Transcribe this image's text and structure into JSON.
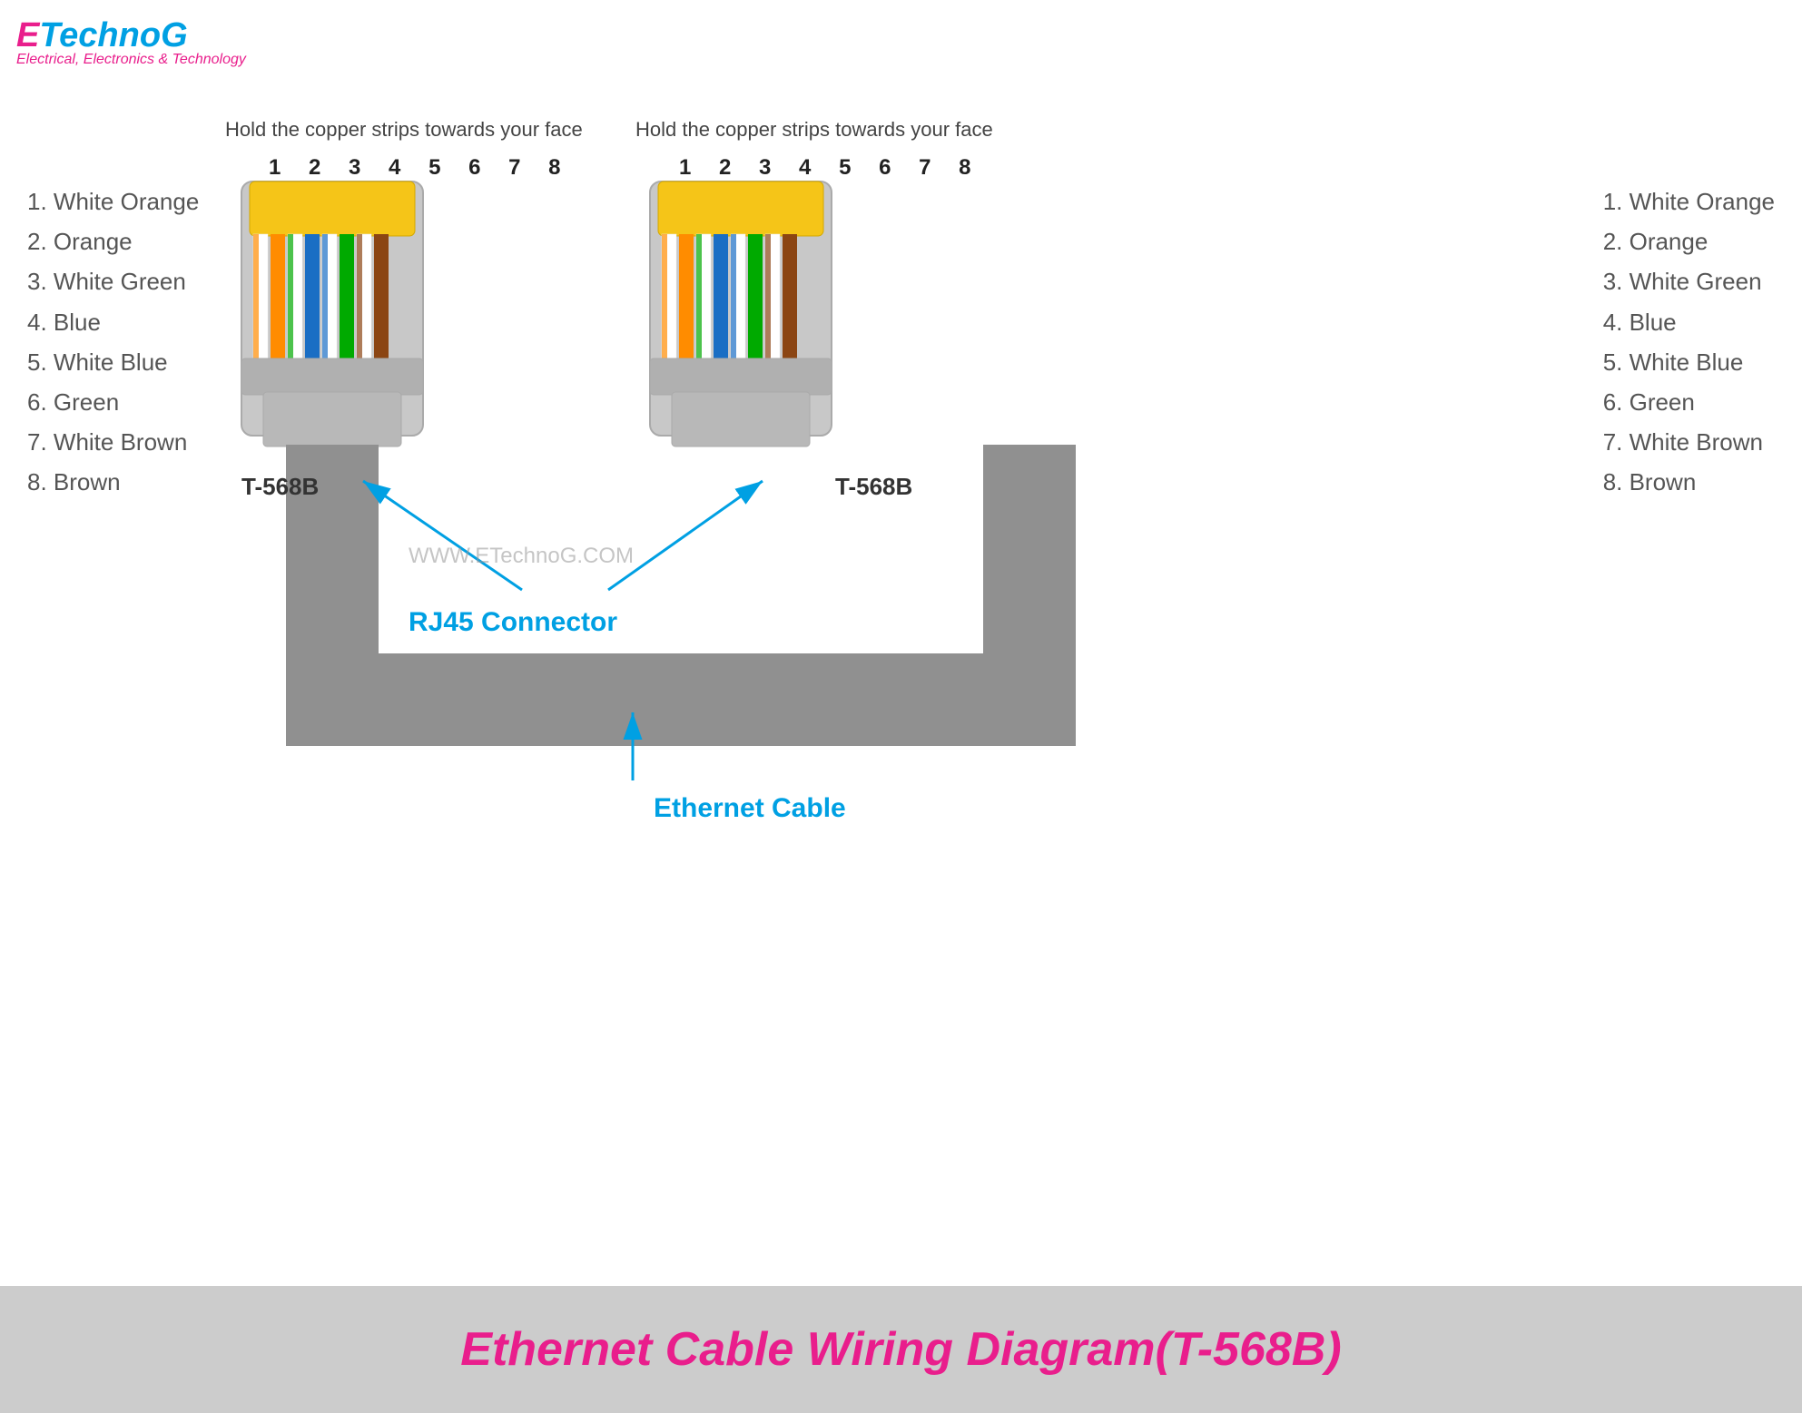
{
  "logo": {
    "e": "E",
    "technog": "TechnoG",
    "tagline": "Electrical, Electronics & Technology"
  },
  "left_connector": {
    "instruction": "Hold the copper strips towards your face",
    "pin_numbers": "1 2 3 4 5 6 7 8",
    "label": "T-568B",
    "wires": [
      {
        "num": "1.",
        "color": "White Orange"
      },
      {
        "num": "2.",
        "color": "Orange"
      },
      {
        "num": "3.",
        "color": "White Green"
      },
      {
        "num": "4.",
        "color": "Blue"
      },
      {
        "num": "5.",
        "color": "White Blue"
      },
      {
        "num": "6.",
        "color": "Green"
      },
      {
        "num": "7.",
        "color": "White Brown"
      },
      {
        "num": "8.",
        "color": "Brown"
      }
    ]
  },
  "right_connector": {
    "instruction": "Hold the copper strips towards your face",
    "pin_numbers": "1 2 3 4 5 6 7 8",
    "label": "T-568B",
    "wires": [
      {
        "num": "1.",
        "color": "White Orange"
      },
      {
        "num": "2.",
        "color": "Orange"
      },
      {
        "num": "3.",
        "color": "White Green"
      },
      {
        "num": "4.",
        "color": "Blue"
      },
      {
        "num": "5.",
        "color": "White Blue"
      },
      {
        "num": "6.",
        "color": "Green"
      },
      {
        "num": "7.",
        "color": "White Brown"
      },
      {
        "num": "8.",
        "color": "Brown"
      }
    ]
  },
  "rj45_label": "RJ45 Connector",
  "ethernet_label": "Ethernet Cable",
  "watermark": "WWW.ETechnoG.COM",
  "bottom_banner": "Ethernet Cable Wiring Diagram(T-568B)"
}
